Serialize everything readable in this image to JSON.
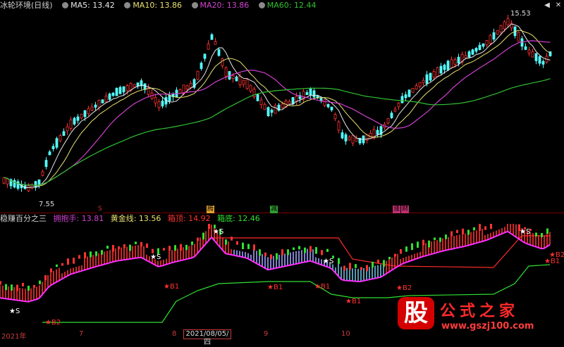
{
  "top_panel": {
    "title": "冰轮环境(日线)",
    "ma": [
      {
        "label": "MA5: 13.42",
        "color": "#e8e8e8"
      },
      {
        "label": "MA10: 13.86",
        "color": "#e8e070"
      },
      {
        "label": "MA20: 13.86",
        "color": "#d040d0"
      },
      {
        "label": "MA60: 12.44",
        "color": "#30c030"
      }
    ],
    "high_label": "15.53",
    "low_label": "7.55",
    "event_marks": [
      {
        "text": "S",
        "color": "#c83030"
      },
      {
        "text": "腾",
        "color": "#e0a030"
      },
      {
        "text": "减",
        "color": "#30a030"
      },
      {
        "text": "涨",
        "color": "#c03070"
      },
      {
        "text": "财",
        "color": "#c03070"
      }
    ]
  },
  "bottom_panel": {
    "title": "稳赚百分之三",
    "items": [
      {
        "label": "拥抱手: 13.81",
        "color": "#d040d0"
      },
      {
        "label": "黄金线: 13.56",
        "color": "#e8e070"
      },
      {
        "label": "箱顶: 14.92",
        "color": "#ff3030"
      },
      {
        "label": "箱底: 12.46",
        "color": "#30e030"
      }
    ],
    "signals": [
      {
        "text": "★S",
        "color": "#ffffff"
      },
      {
        "text": "★S",
        "color": "#ffffff"
      },
      {
        "text": "★S",
        "color": "#ffffff"
      },
      {
        "text": "★S",
        "color": "#ffffff"
      },
      {
        "text": "★S",
        "color": "#ffffff"
      },
      {
        "text": "★B1",
        "color": "#ff3030"
      },
      {
        "text": "★B1",
        "color": "#ff3030"
      },
      {
        "text": "★B1",
        "color": "#ff3030"
      },
      {
        "text": "★B2",
        "color": "#ff3030"
      },
      {
        "text": "★B1",
        "color": "#ff3030"
      },
      {
        "text": "★B2",
        "color": "#ff3030"
      },
      {
        "text": "★B2",
        "color": "#ff3030"
      },
      {
        "text": "★B1",
        "color": "#ff3030"
      }
    ]
  },
  "time_axis": {
    "labels": [
      "2021年",
      "7",
      "8",
      "9",
      "10"
    ],
    "cursor_date": "2021/08/05/四"
  },
  "watermark": {
    "badge": "股",
    "brand": "公式之家",
    "url": "www.gszj100.com"
  },
  "icons": {
    "window_buttons": [
      "arrow-left-icon",
      "close-icon"
    ]
  }
}
